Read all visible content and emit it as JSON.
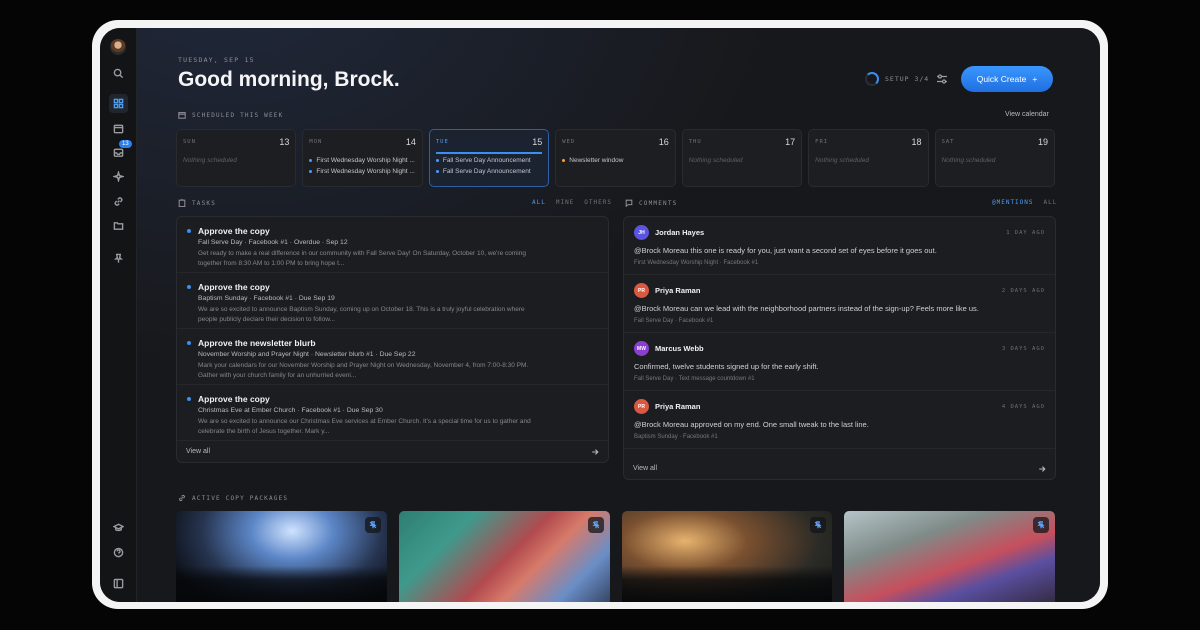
{
  "header": {
    "date": "TUESDAY, SEP 15",
    "greeting": "Good morning, Brock.",
    "setup_label": "SETUP 3/4",
    "quick_create_label": "Quick Create",
    "quick_create_icon": "+"
  },
  "sidebar": {
    "inbox_badge": "13",
    "icons": [
      "search-icon",
      "dashboard-icon",
      "calendar-icon",
      "inbox-icon",
      "sparkle-icon",
      "link-icon",
      "folder-icon",
      "pin-icon",
      "graduation-cap-icon",
      "help-icon",
      "panel-icon"
    ]
  },
  "week": {
    "label": "SCHEDULED THIS WEEK",
    "view_calendar": "View calendar",
    "days": [
      {
        "name": "SUN",
        "num": "13",
        "empty": "Nothing scheduled"
      },
      {
        "name": "MON",
        "num": "14",
        "events": [
          "First Wednesday Worship Night ...",
          "First Wednesday Worship Night ..."
        ]
      },
      {
        "name": "TUE",
        "num": "15",
        "events": [
          "Fall Serve Day Announcement",
          "Fall Serve Day Announcement"
        ]
      },
      {
        "name": "WED",
        "num": "16",
        "events": [
          "Newsletter window"
        ]
      },
      {
        "name": "THU",
        "num": "17",
        "empty": "Nothing scheduled"
      },
      {
        "name": "FRI",
        "num": "18",
        "empty": "Nothing scheduled"
      },
      {
        "name": "SAT",
        "num": "19",
        "empty": "Nothing scheduled"
      }
    ]
  },
  "tasks": {
    "label": "TASKS",
    "tabs": [
      "ALL",
      "MINE",
      "OTHERS"
    ],
    "view_all": "View all",
    "items": [
      {
        "title": "Approve the copy",
        "meta": "Fall Serve Day · Facebook #1 · Overdue · Sep 12",
        "body": "Get ready to make a real difference in our community with Fall Serve Day! On Saturday, October 10, we're coming together from 8:30 AM to 1:00 PM to bring hope t..."
      },
      {
        "title": "Approve the copy",
        "meta": "Baptism Sunday · Facebook #1 · Due Sep 19",
        "body": "We are so excited to announce Baptism Sunday, coming up on October 18. This is a truly joyful celebration where people publicly declare their decision to follow..."
      },
      {
        "title": "Approve the newsletter blurb",
        "meta": "November Worship and Prayer Night · Newsletter blurb #1 · Due Sep 22",
        "body": "Mark your calendars for our November Worship and Prayer Night on Wednesday, November 4, from 7:00-8:30 PM. Gather with your church family for an unhurried eveni..."
      },
      {
        "title": "Approve the copy",
        "meta": "Christmas Eve at Ember Church · Facebook #1 · Due Sep 30",
        "body": "We are so excited to announce our Christmas Eve services at Ember Church. It's a special time for us to gather and celebrate the birth of Jesus together. Mark y..."
      }
    ]
  },
  "comments": {
    "label": "COMMENTS",
    "tabs": [
      "@MENTIONS",
      "ALL"
    ],
    "view_all": "View all",
    "items": [
      {
        "initials": "JH",
        "name": "Jordan Hayes",
        "time": "1 DAY AGO",
        "text": "@Brock Moreau this one is ready for you, just want a second set of eyes before it goes out.",
        "sub": "First Wednesday Worship Night · Facebook #1",
        "color": "#5b54e0"
      },
      {
        "initials": "PR",
        "name": "Priya Raman",
        "time": "2 DAYS AGO",
        "text": "@Brock Moreau can we lead with the neighborhood partners instead of the sign-up? Feels more like us.",
        "sub": "Fall Serve Day · Facebook #1",
        "color": "#d9583f"
      },
      {
        "initials": "MW",
        "name": "Marcus Webb",
        "time": "3 DAYS AGO",
        "text": "Confirmed, twelve students signed up for the early shift.",
        "sub": "Fall Serve Day · Text message countdown #1",
        "color": "#8a3fd1"
      },
      {
        "initials": "PR",
        "name": "Priya Raman",
        "time": "4 DAYS AGO",
        "text": "@Brock Moreau approved on my end. One small tweak to the last line.",
        "sub": "Baptism Sunday · Facebook #1",
        "color": "#d9583f"
      }
    ]
  },
  "packages": {
    "label": "ACTIVE COPY PACKAGES",
    "items": [
      "concert-crowd-image",
      "stacked-hands-image",
      "people-laughing-image",
      "outdoor-gathering-image"
    ]
  }
}
